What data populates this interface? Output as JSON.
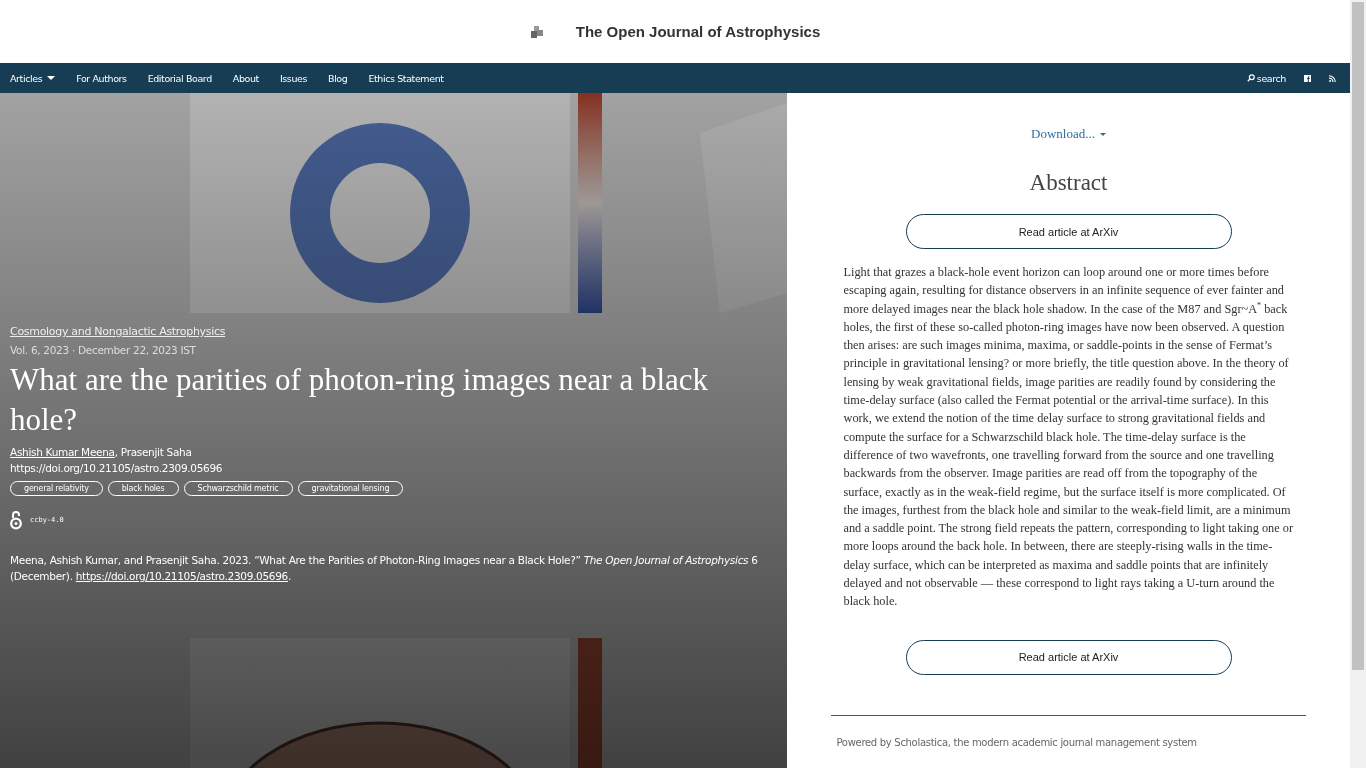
{
  "header": {
    "title": "The Open Journal of Astrophysics"
  },
  "nav": {
    "items": [
      {
        "label": "Articles",
        "dropdown": true
      },
      {
        "label": "For Authors",
        "dropdown": false
      },
      {
        "label": "Editorial Board",
        "dropdown": false
      },
      {
        "label": "About",
        "dropdown": false
      },
      {
        "label": "Issues",
        "dropdown": false
      },
      {
        "label": "Blog",
        "dropdown": false
      },
      {
        "label": "Ethics Statement",
        "dropdown": false
      }
    ],
    "search": "search"
  },
  "article": {
    "category": "Cosmology and Nongalactic Astrophysics",
    "meta": "Vol. 6, 2023 · December 22, 2023 IST",
    "title": "What are the parities of photon-ring images near a black hole?",
    "authors": [
      {
        "name": "Ashish Kumar Meena",
        "linked": true
      },
      {
        "name": "Prasenjit Saha",
        "linked": false
      }
    ],
    "author_separator": ", ",
    "doi": "https://doi.org/10.21105/astro.2309.05696",
    "tags": [
      "general relativity",
      "black holes",
      "Schwarzschild metric",
      "gravitational lensing"
    ],
    "license": "ccby-4.0",
    "citation": {
      "text": "Meena, Ashish Kumar, and Prasenjit Saha. 2023. “What Are the Parities of Photon-Ring Images near a Black Hole?” *The Open Journal of Astrophysics* 6 (December).",
      "link": "https://doi.org/10.21105/astro.2309.05696",
      "after": "."
    }
  },
  "side": {
    "download": "Download...",
    "abstract_heading": "Abstract",
    "button_top": "Read article at ArXiv",
    "abstract": "Light that grazes a black-hole event horizon can loop around one or more times before escaping again, resulting for distance observers in an infinite sequence of ever fainter and more delayed images near the black hole shadow. In the case of the M87 and Sgr~A$^{*}$ back holes, the first of these so-called photon-ring images have now been observed. A question then arises: are such images minima, maxima, or saddle-points in the sense of Fermat’s principle in gravitational lensing? or more briefly, the title question above. In the theory of lensing by weak gravitational fields, image parities are readily found by considering the time-delay surface (also called the Fermat potential or the arrival-time surface). In this work, we extend the notion of the time delay surface to strong gravitational fields and compute the surface for a Schwarzschild black hole. The time-delay surface is the difference of two wavefronts, one travelling forward from the source and one travelling backwards from the observer. Image parities are read off from the topography of the surface, exactly as in the weak-field regime, but the surface itself is more complicated. Of the images, furthest from the black hole and similar to the weak-field limit, are a minimum and a saddle point. The strong field repeats the pattern, corresponding to light taking one or more loops around the back hole. In between, there are steeply-rising walls in the time-delay surface, which can be interpreted as maxima and saddle points that are infinitely delayed and not observable — these correspond to light rays taking a U-turn around the black hole.",
    "button_bottom": "Read article at ArXiv",
    "footer": "Powered by Scholastica, the modern academic journal management system"
  }
}
